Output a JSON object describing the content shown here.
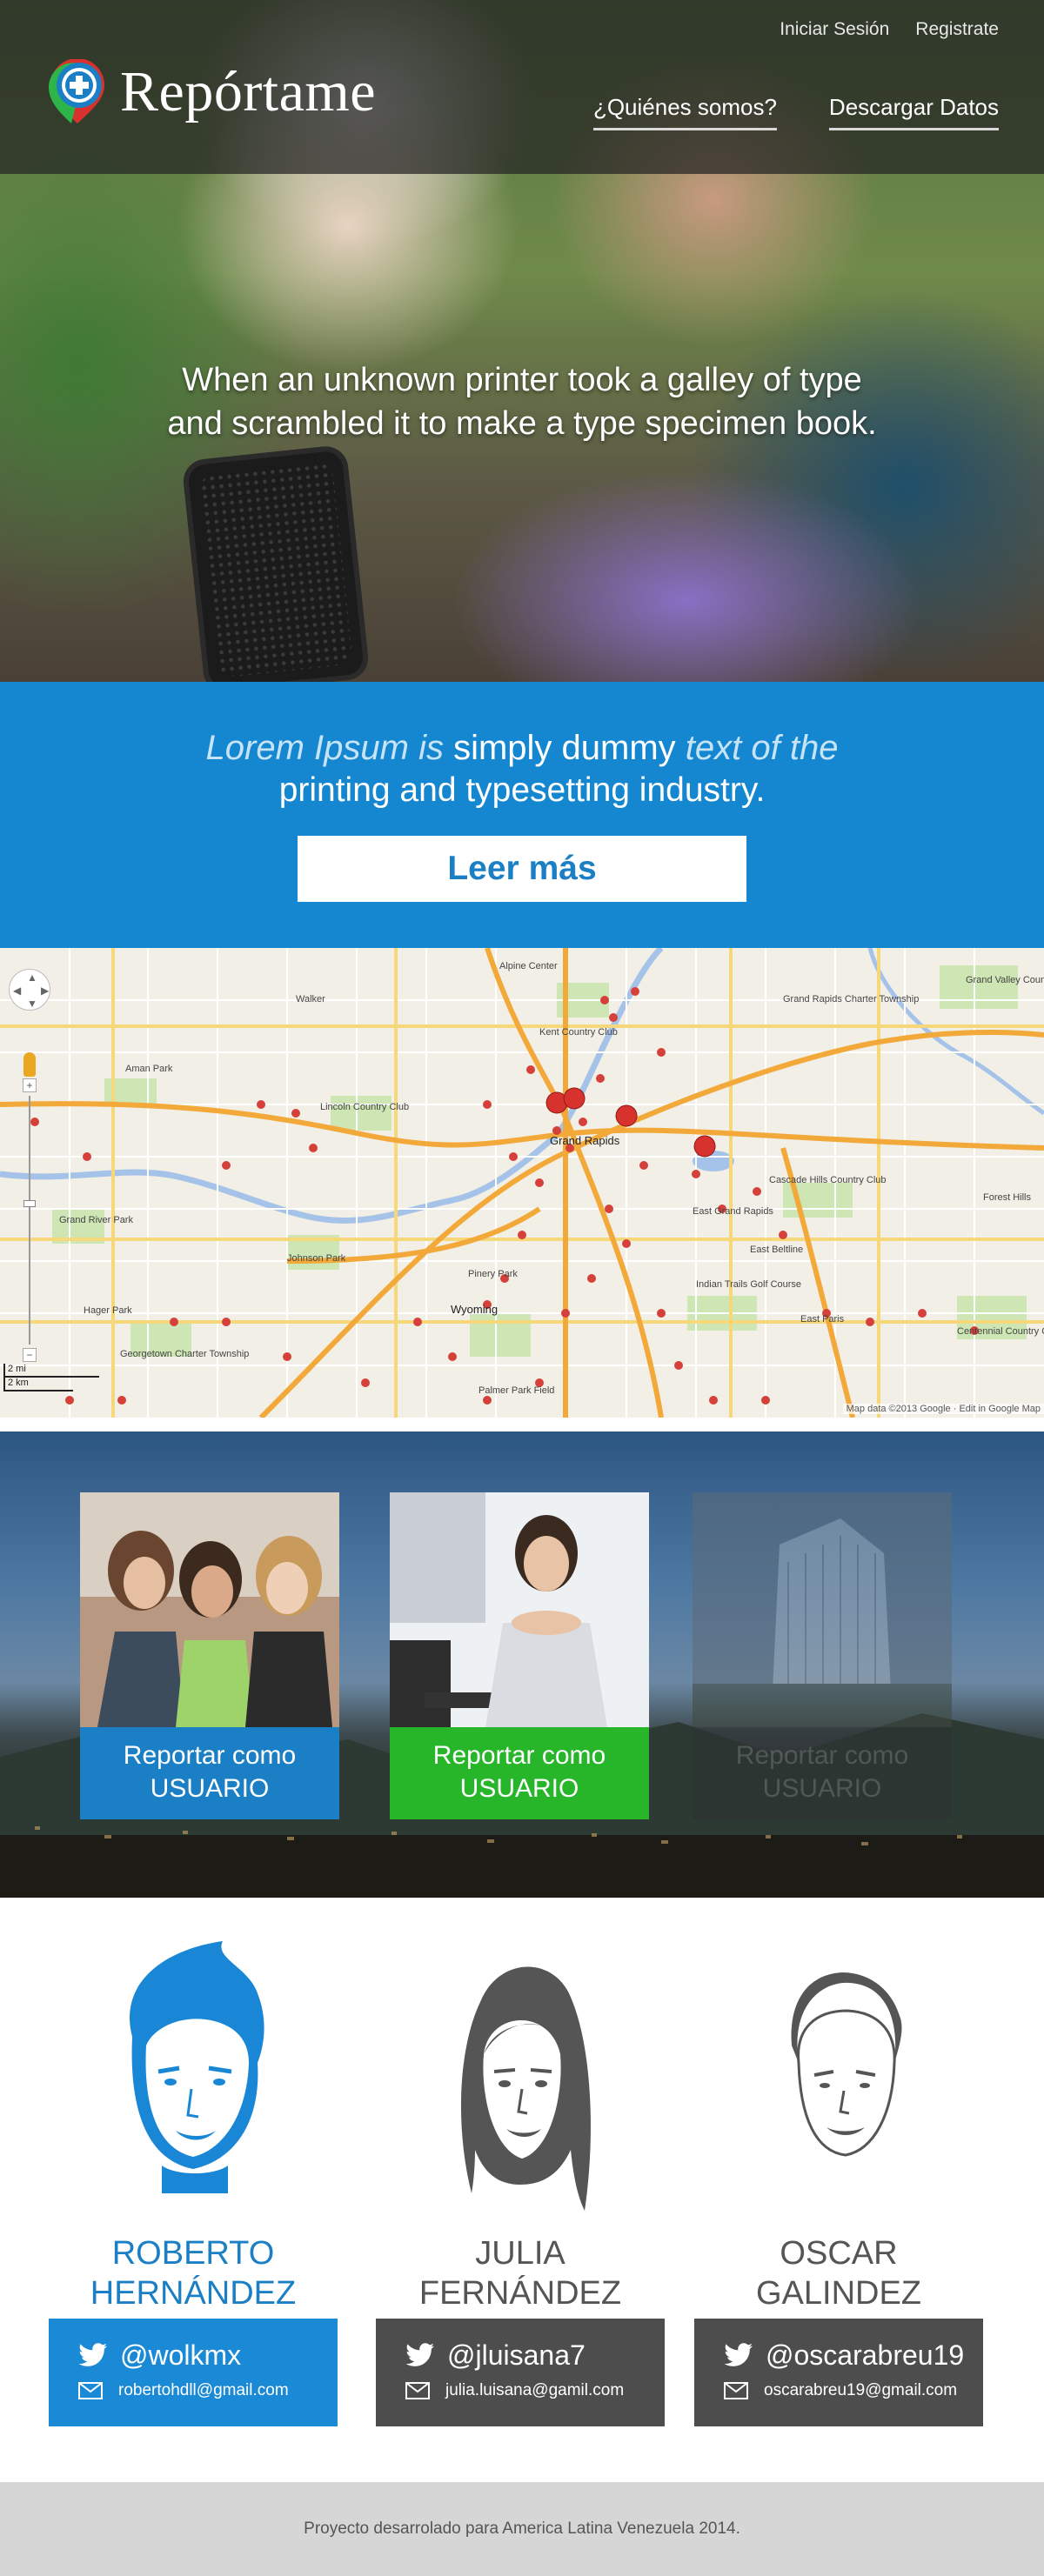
{
  "header": {
    "brand": "Repórtame",
    "login": "Iniciar Sesión",
    "register": "Registrate",
    "nav": [
      "¿Quiénes somos?",
      "Descargar Datos"
    ]
  },
  "hero": {
    "line1": "When an unknown printer took a galley of type",
    "line2": "and scrambled it to make a type specimen book."
  },
  "promo": {
    "part1": "Lorem Ipsum is ",
    "highlight1": "simply dummy",
    "part2": " text of the",
    "line2": "printing and typesetting industry.",
    "button": "Leer más"
  },
  "map": {
    "scale_mi": "2 mi",
    "scale_km": "2 km",
    "attribution": "Map data ©2013 Google · Edit in Google Map",
    "labels": [
      "Walker",
      "Grand Rapids",
      "Grand Rapids Charter Township",
      "Cascade Hills Country Club",
      "East Grand Rapids",
      "East Beltline",
      "Wyoming",
      "Georgetown Charter Township",
      "Johnson Park",
      "Pinery Park",
      "Palmer Park Field",
      "Indian Trails Golf Course",
      "Forest Hills",
      "Grand Valley Country Club",
      "Centennial Country Club",
      "Aman Park",
      "Lincoln Country Club",
      "Grand River Park",
      "Hager Park",
      "Kent Country Club",
      "Alpine Center",
      "East Paris"
    ]
  },
  "cards": [
    {
      "line1": "Reportar como",
      "line2": "USUARIO"
    },
    {
      "line1": "Reportar como",
      "line2": "USUARIO"
    },
    {
      "line1": "Reportar como",
      "line2": "USUARIO"
    }
  ],
  "team": [
    {
      "first": "ROBERTO",
      "last": "HERNÁNDEZ",
      "twitter": "@wolkmx",
      "email": "robertohdll@gmail.com"
    },
    {
      "first": "JULIA",
      "last": "FERNÁNDEZ",
      "twitter": "@jluisana7",
      "email": "julia.luisana@gamil.com"
    },
    {
      "first": "OSCAR",
      "last": "GALINDEZ",
      "twitter": "@oscarabreu19",
      "email": "oscarabreu19@gmail.com"
    }
  ],
  "footer": {
    "text": "Proyecto desarrolado para America Latina  Venezuela 2014."
  },
  "colors": {
    "primary_blue": "#1587d0",
    "card_green": "#27b52a",
    "team_gray": "#4d4d4d",
    "footer_gray": "#d6d6d6"
  }
}
